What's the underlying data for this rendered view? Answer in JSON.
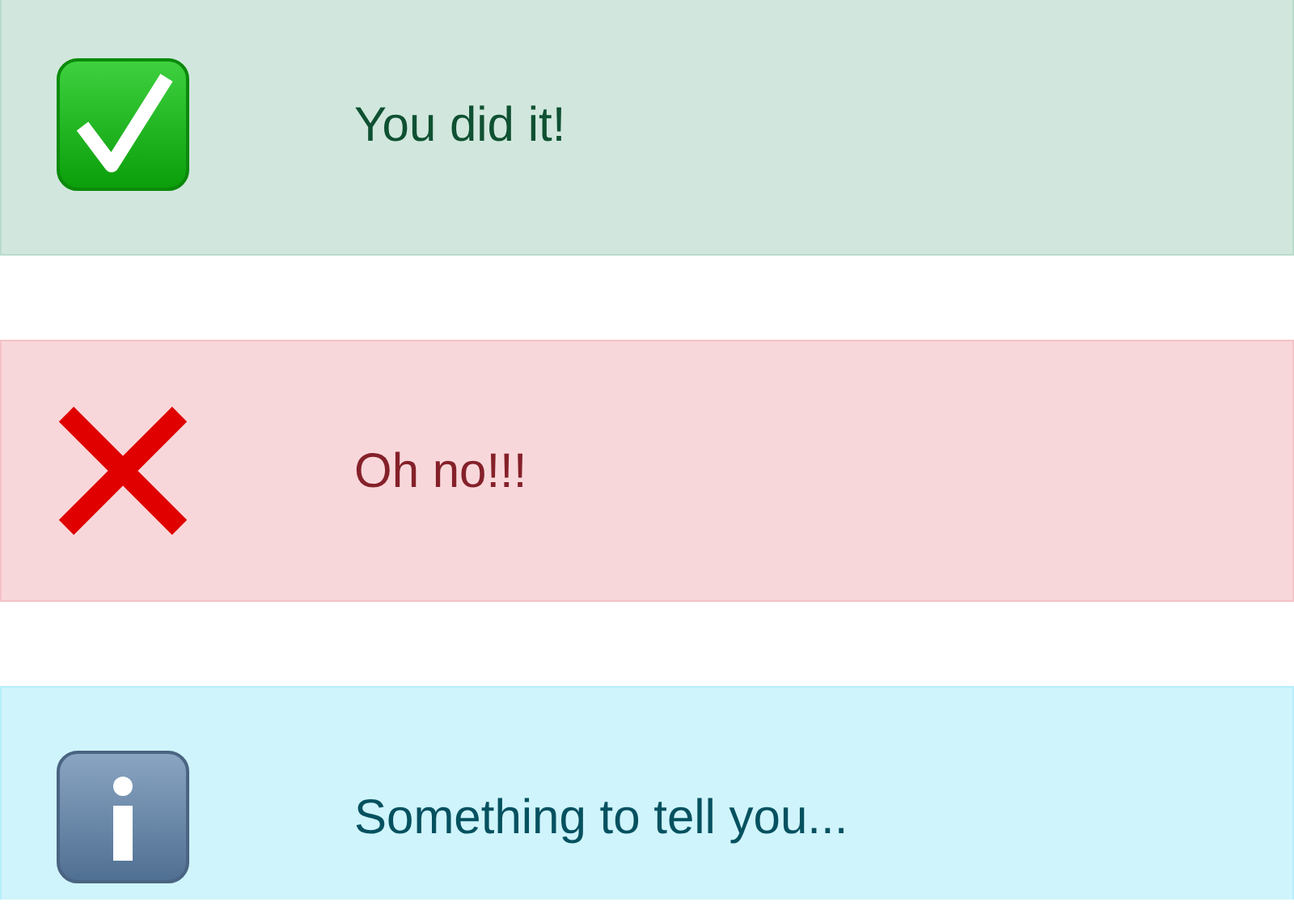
{
  "alerts": [
    {
      "kind": "success",
      "message": "You did it!"
    },
    {
      "kind": "danger",
      "message": "Oh no!!!"
    },
    {
      "kind": "info",
      "message": "Something to tell you..."
    }
  ]
}
